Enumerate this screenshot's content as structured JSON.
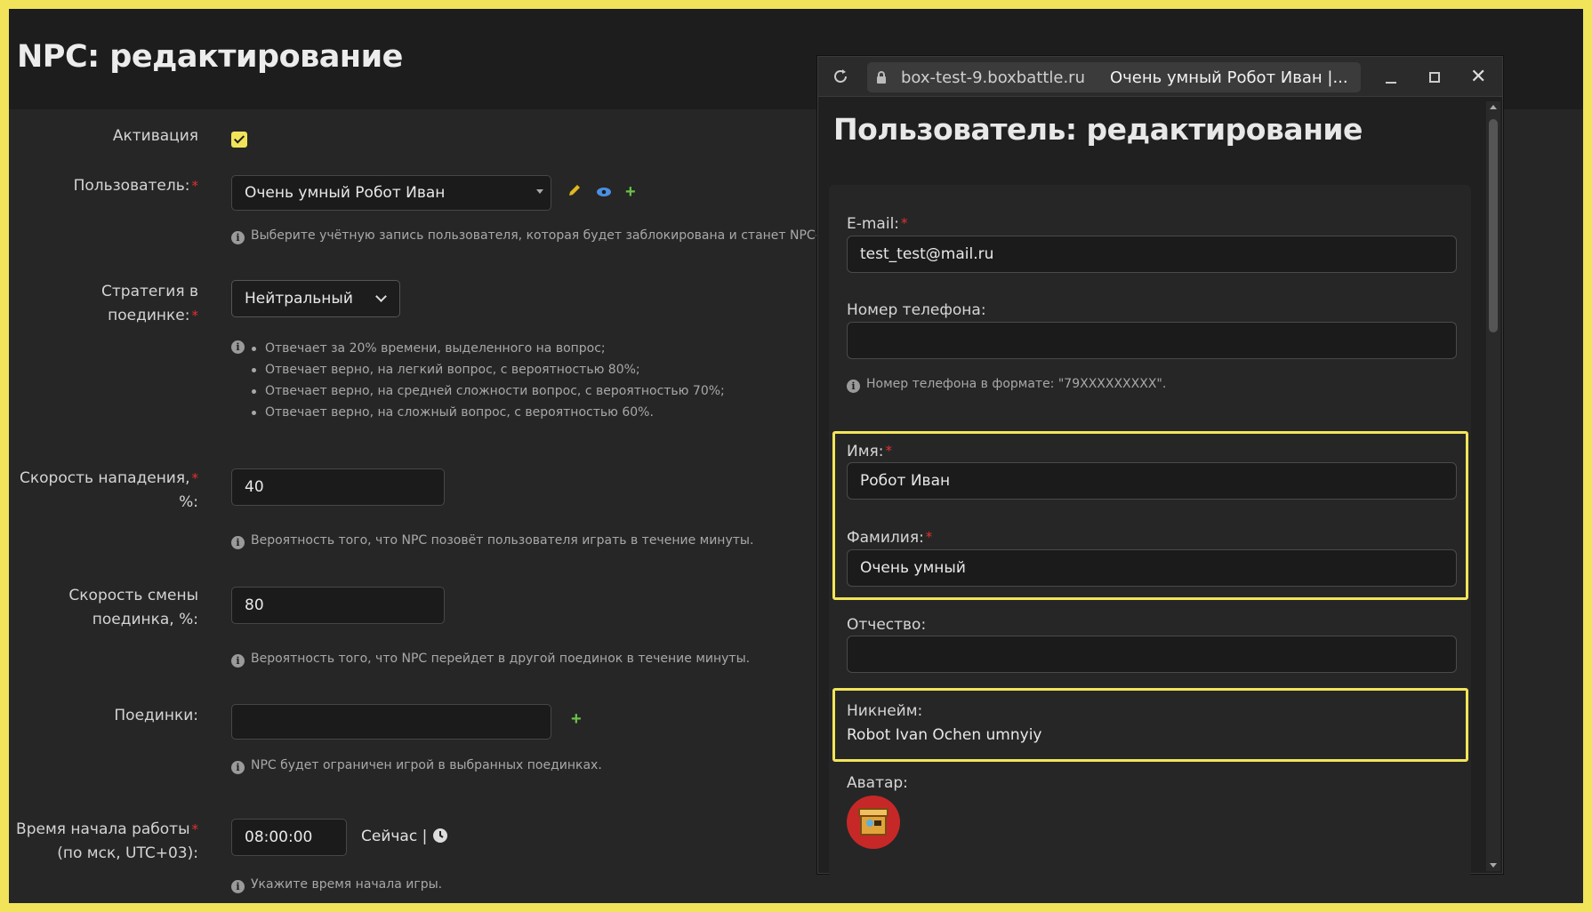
{
  "page": {
    "title": "NPC: редактирование"
  },
  "form": {
    "activation": {
      "label": "Активация",
      "checked": true
    },
    "user": {
      "label": "Пользователь:",
      "value": "Очень умный Робот Иван",
      "help": "Выберите учётную запись пользователя, которая будет заблокирована и станет NPC-бо"
    },
    "strategy": {
      "label": "Стратегия в поединке:",
      "value": "Нейтральный",
      "bullets": [
        "Отвечает за 20% времени, выделенного на вопрос;",
        "Отвечает верно, на легкий вопрос, с вероятностью 80%;",
        "Отвечает верно, на средней сложности вопрос, с вероятностью 70%;",
        "Отвечает верно, на сложный вопрос, с вероятностью 60%."
      ]
    },
    "attack_speed": {
      "label_line1": "Скорость нападения,",
      "label_line2": "%:",
      "value": "40",
      "help": "Вероятность того, что NPC позовёт пользователя играть в течение минуты."
    },
    "switch_speed": {
      "label_line1": "Скорость смены",
      "label_line2": "поединка, %:",
      "value": "80",
      "help": "Вероятность того, что NPC перейдет в другой поединок в течение минуты."
    },
    "battles": {
      "label": "Поединки:",
      "value": "",
      "help": "NPC будет ограничен игрой в выбранных поединках."
    },
    "start_time": {
      "label_line1": "Время начала работы",
      "label_line2": "(по мск, UTC+03):",
      "value": "08:00:00",
      "now_label": "Сейчас |",
      "help": "Укажите время начала игры."
    },
    "required_mark": "*"
  },
  "popup": {
    "domain": "box-test-9.boxbattle.ru",
    "tab_title": "Очень умный Робот Иван |...",
    "title": "Пользователь: редактирование",
    "email": {
      "label": "E-mail:",
      "value": "test_test@mail.ru"
    },
    "phone": {
      "label": "Номер телефона:",
      "value": "",
      "help": "Номер телефона в формате: \"79XXXXXXXXX\"."
    },
    "first_name": {
      "label": "Имя:",
      "value": "Робот Иван"
    },
    "last_name": {
      "label": "Фамилия:",
      "value": "Очень умный"
    },
    "middle_name": {
      "label": "Отчество:",
      "value": ""
    },
    "nickname": {
      "label": "Никнейм:",
      "value": "Robot Ivan Ochen umnyiy"
    },
    "avatar": {
      "label": "Аватар:"
    }
  },
  "colors": {
    "accent": "#f2e45a",
    "required": "#e03131",
    "background": "#1d1d1d"
  },
  "icons": [
    "info-icon",
    "pencil-icon",
    "eye-icon",
    "plus-icon",
    "clock-icon",
    "reload-icon",
    "lock-icon",
    "minimize-icon",
    "maximize-icon",
    "close-icon"
  ]
}
